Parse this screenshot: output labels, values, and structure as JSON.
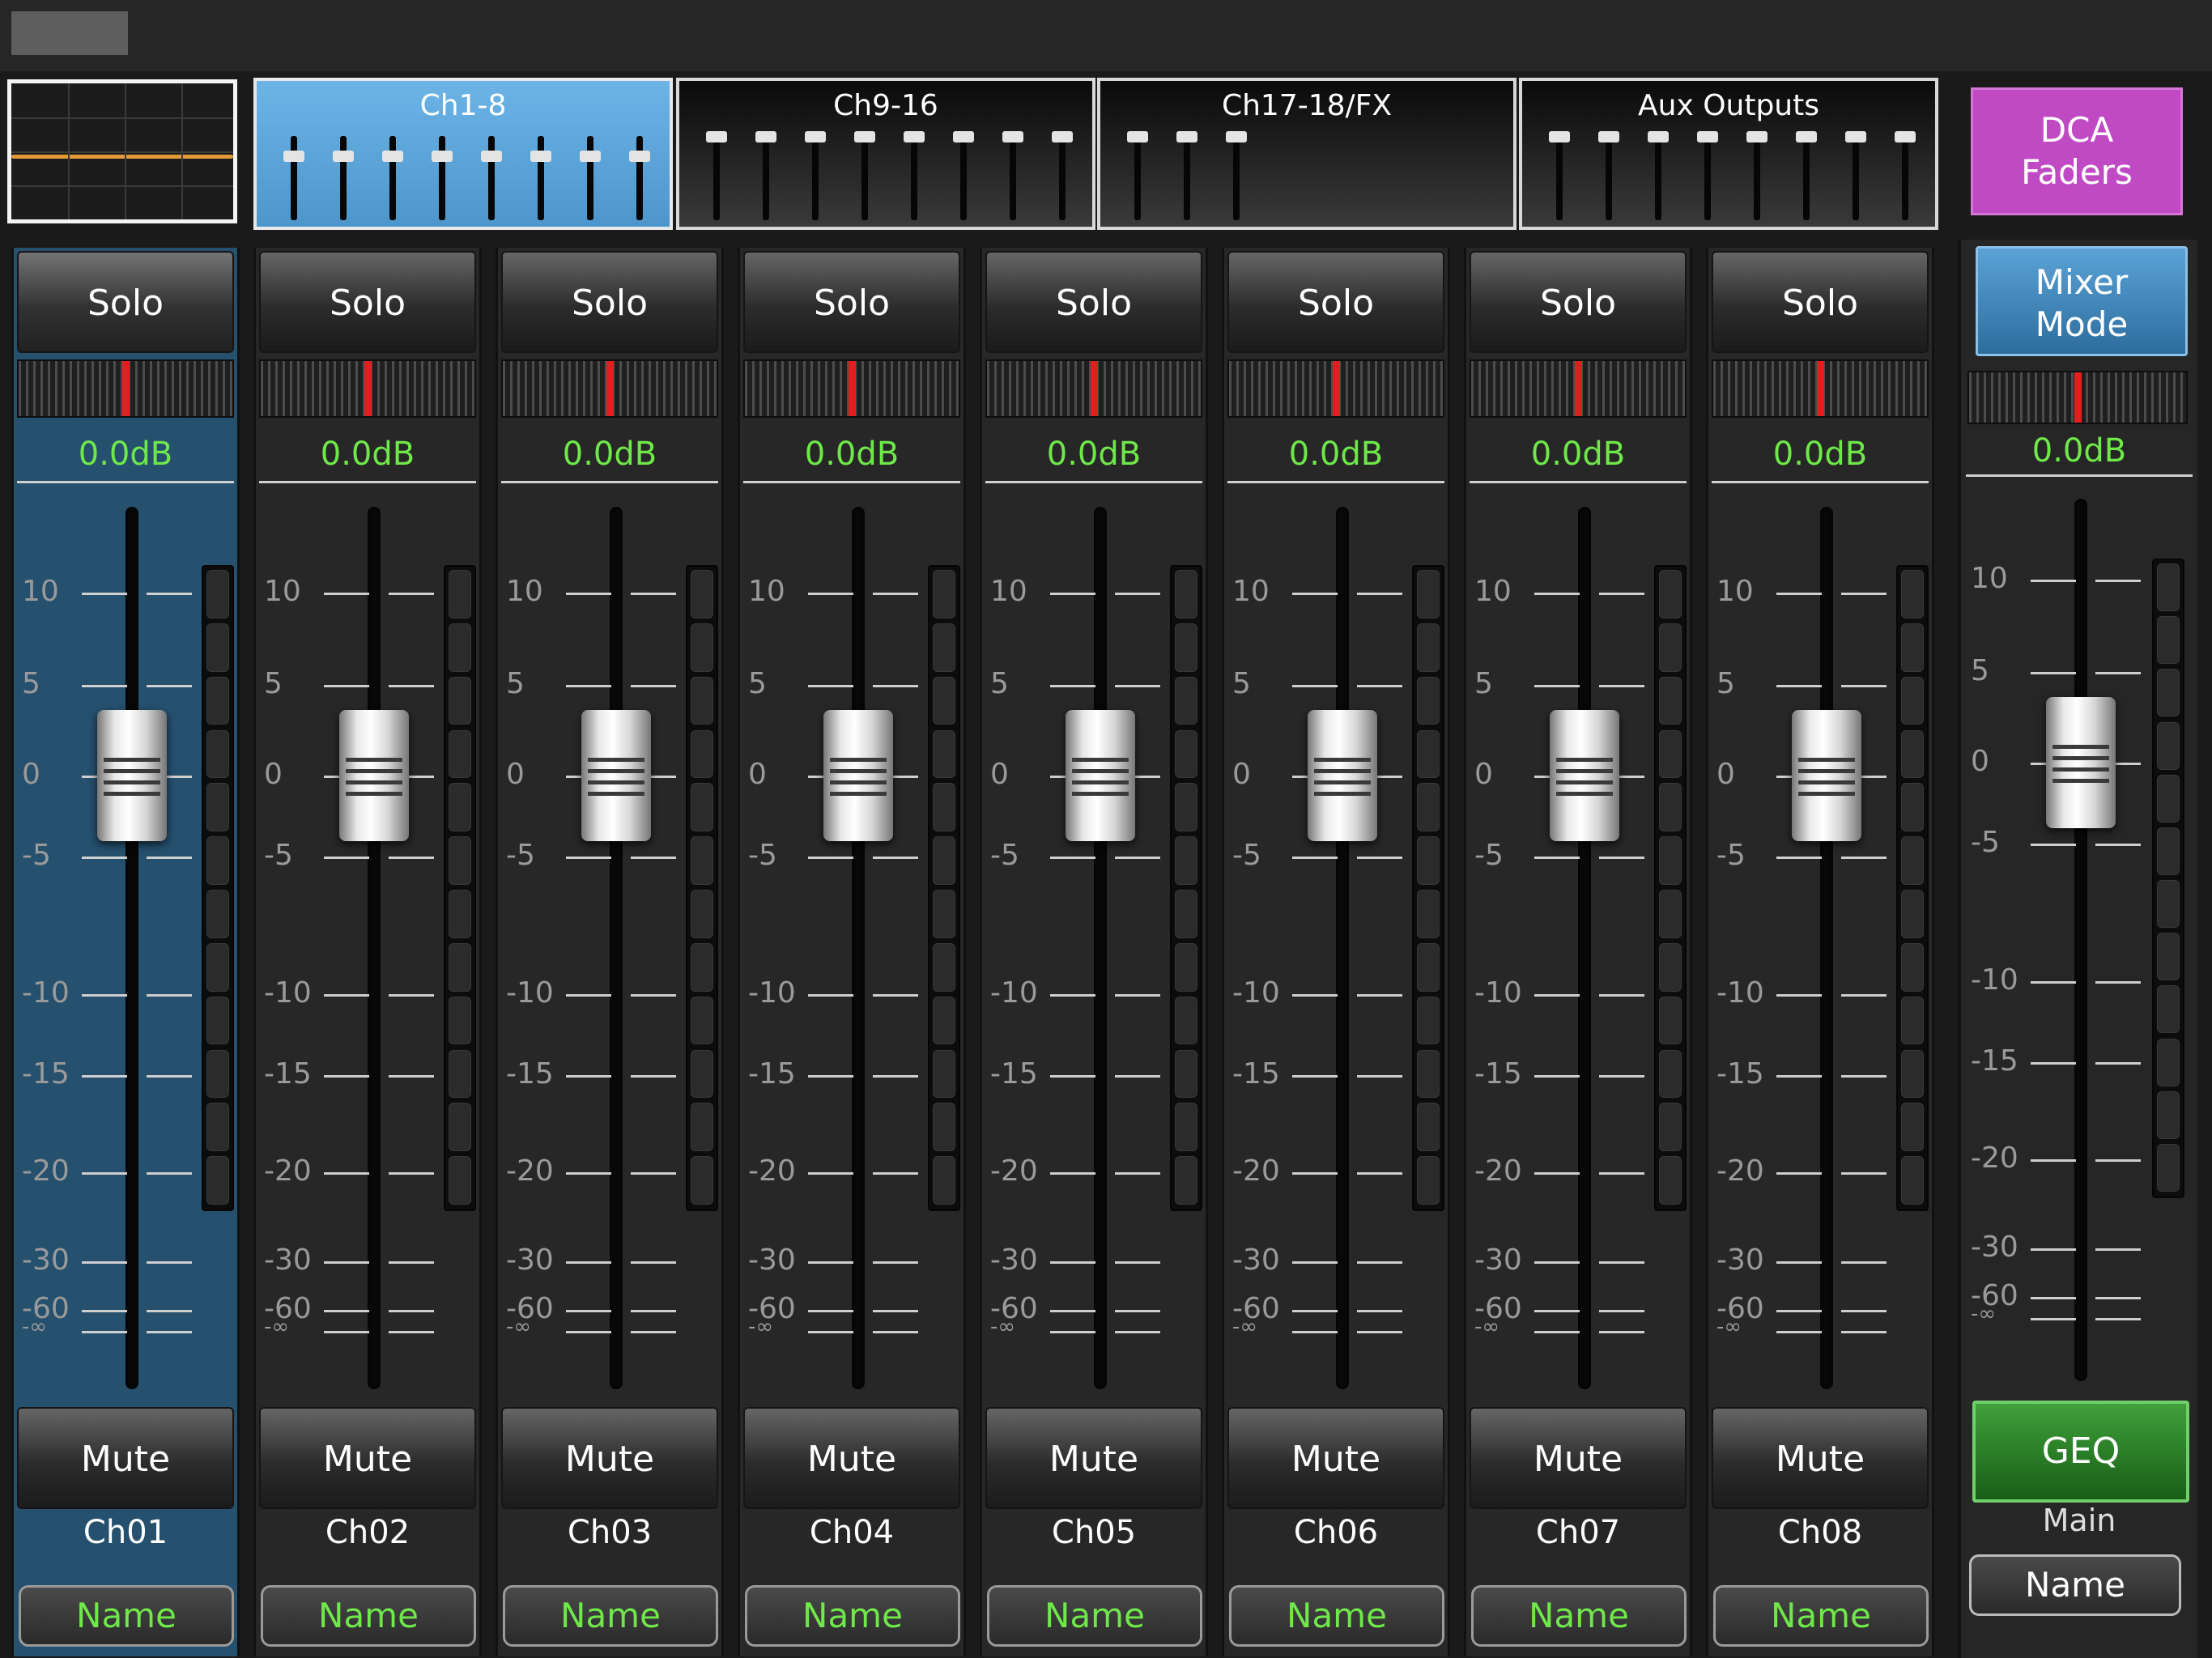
{
  "banks": [
    {
      "label": "Ch1-8",
      "active": true,
      "fader_count": 8
    },
    {
      "label": "Ch9-16",
      "active": false,
      "fader_count": 8
    },
    {
      "label": "Ch17-18/FX",
      "active": false,
      "fader_count": 3
    },
    {
      "label": "Aux Outputs",
      "active": false,
      "fader_count": 8
    }
  ],
  "dca_button": {
    "line1": "DCA",
    "line2": "Faders"
  },
  "scale_labels": [
    "10",
    "5",
    "0",
    "-5",
    "-10",
    "-15",
    "-20",
    "-30",
    "-60",
    "-∞"
  ],
  "channels": [
    {
      "solo": "Solo",
      "db": "0.0dB",
      "mute": "Mute",
      "id": "Ch01",
      "name": "Name",
      "selected": true,
      "fader_db": 0,
      "pan": 0.5
    },
    {
      "solo": "Solo",
      "db": "0.0dB",
      "mute": "Mute",
      "id": "Ch02",
      "name": "Name",
      "selected": false,
      "fader_db": 0,
      "pan": 0.5
    },
    {
      "solo": "Solo",
      "db": "0.0dB",
      "mute": "Mute",
      "id": "Ch03",
      "name": "Name",
      "selected": false,
      "fader_db": 0,
      "pan": 0.5
    },
    {
      "solo": "Solo",
      "db": "0.0dB",
      "mute": "Mute",
      "id": "Ch04",
      "name": "Name",
      "selected": false,
      "fader_db": 0,
      "pan": 0.5
    },
    {
      "solo": "Solo",
      "db": "0.0dB",
      "mute": "Mute",
      "id": "Ch05",
      "name": "Name",
      "selected": false,
      "fader_db": 0,
      "pan": 0.5
    },
    {
      "solo": "Solo",
      "db": "0.0dB",
      "mute": "Mute",
      "id": "Ch06",
      "name": "Name",
      "selected": false,
      "fader_db": 0,
      "pan": 0.5
    },
    {
      "solo": "Solo",
      "db": "0.0dB",
      "mute": "Mute",
      "id": "Ch07",
      "name": "Name",
      "selected": false,
      "fader_db": 0,
      "pan": 0.5
    },
    {
      "solo": "Solo",
      "db": "0.0dB",
      "mute": "Mute",
      "id": "Ch08",
      "name": "Name",
      "selected": false,
      "fader_db": 0,
      "pan": 0.5
    }
  ],
  "master": {
    "mixer_mode": {
      "line1": "Mixer",
      "line2": "Mode"
    },
    "db": "0.0dB",
    "fader_db": 0,
    "pan": 0.5,
    "geq": "GEQ",
    "label": "Main",
    "name": "Name"
  },
  "colors": {
    "accent_blue": "#4d96cc",
    "dca_purple": "#c04ac4",
    "geq_green": "#3fa03a",
    "level_text": "#6fe84a",
    "pan_red": "#e02020"
  }
}
